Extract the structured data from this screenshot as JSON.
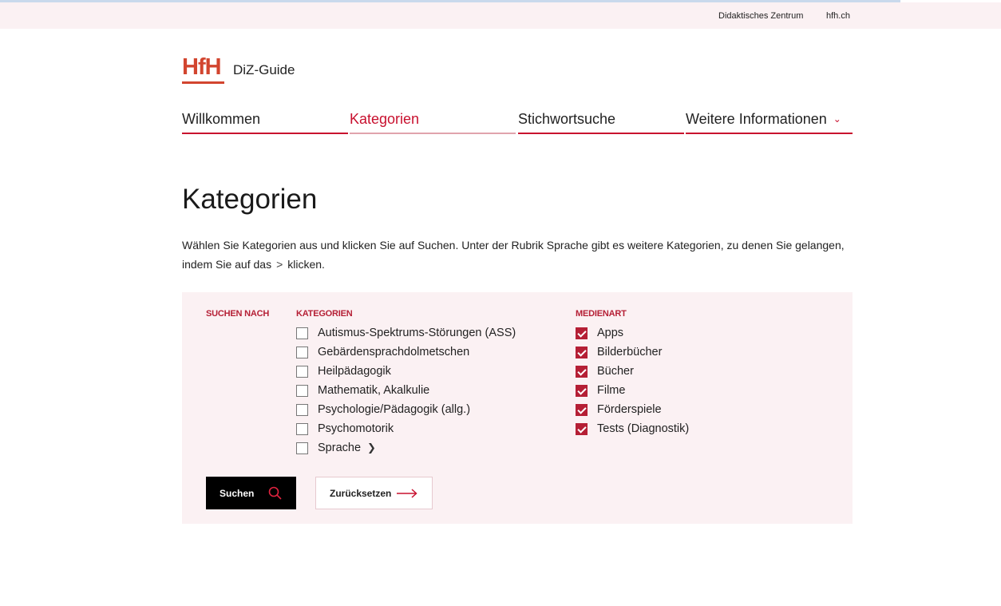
{
  "topbar": {
    "links": [
      "Didaktisches Zentrum",
      "hfh.ch"
    ]
  },
  "brand": {
    "logo_text": "HfH",
    "app_name": "DiZ-Guide"
  },
  "nav": {
    "tabs": [
      "Willkommen",
      "Kategorien",
      "Stichwortsuche",
      "Weitere Informationen"
    ],
    "active": "Kategorien"
  },
  "page": {
    "title": "Kategorien",
    "intro_before": "Wählen Sie Kategorien aus und klicken Sie auf Suchen. Unter der Rubrik Sprache gibt es weitere Kategorien, zu denen Sie gelangen, indem Sie auf das",
    "intro_glyph": ">",
    "intro_after": "klicken."
  },
  "filters": {
    "search_by_label": "SUCHEN NACH",
    "categories_label": "KATEGORIEN",
    "categories": [
      {
        "label": "Autismus-Spektrums-Störungen (ASS)",
        "checked": false
      },
      {
        "label": "Gebärdensprachdolmetschen",
        "checked": false
      },
      {
        "label": "Heilpädagogik",
        "checked": false
      },
      {
        "label": "Mathematik, Akalkulie",
        "checked": false
      },
      {
        "label": "Psychologie/Pädagogik (allg.)",
        "checked": false
      },
      {
        "label": "Psychomotorik",
        "checked": false
      },
      {
        "label": "Sprache",
        "checked": false
      }
    ],
    "media_label": "MEDIENART",
    "media": [
      {
        "label": "Apps",
        "checked": true
      },
      {
        "label": "Bilderbücher",
        "checked": true
      },
      {
        "label": "Bücher",
        "checked": true
      },
      {
        "label": "Filme",
        "checked": true
      },
      {
        "label": "Förderspiele",
        "checked": true
      },
      {
        "label": "Tests (Diagnostik)",
        "checked": true
      }
    ]
  },
  "buttons": {
    "search": "Suchen",
    "reset": "Zurücksetzen"
  },
  "colors": {
    "accent": "#c8102e",
    "brand": "#d2452f",
    "panel_bg": "#fbf1f3"
  }
}
